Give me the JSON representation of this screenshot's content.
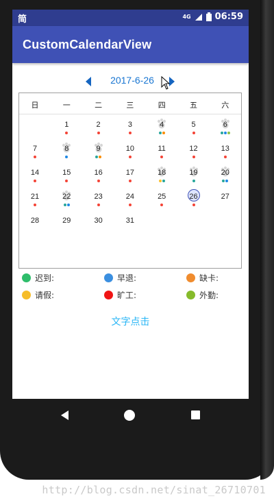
{
  "status_bar": {
    "carrier_icon_text": "简",
    "signal": "4G",
    "time": "06:59"
  },
  "app_bar": {
    "title": "CustomCalendarView"
  },
  "month_nav": {
    "label": "2017-6-26"
  },
  "calendar": {
    "weekdays": [
      "日",
      "一",
      "二",
      "三",
      "四",
      "五",
      "六"
    ],
    "days": [
      {
        "day": "1",
        "col": 1,
        "row": 0,
        "dots": [
          "#f44336"
        ]
      },
      {
        "day": "2",
        "col": 2,
        "row": 0,
        "dots": [
          "#f44336"
        ]
      },
      {
        "day": "3",
        "col": 3,
        "row": 0,
        "dots": [
          "#f44336"
        ]
      },
      {
        "day": "4",
        "col": 4,
        "row": 0,
        "paw": true,
        "dots": [
          "#26a69a",
          "#fb8c00"
        ]
      },
      {
        "day": "5",
        "col": 5,
        "row": 0,
        "dots": [
          "#f44336"
        ]
      },
      {
        "day": "6",
        "col": 6,
        "row": 0,
        "paw": true,
        "dots": [
          "#26a69a",
          "#1e88e5",
          "#8bc34a"
        ]
      },
      {
        "day": "7",
        "col": 0,
        "row": 1,
        "dots": [
          "#f44336"
        ]
      },
      {
        "day": "8",
        "col": 1,
        "row": 1,
        "paw": true,
        "dots": [
          "#1e88e5"
        ]
      },
      {
        "day": "9",
        "col": 2,
        "row": 1,
        "paw": true,
        "dots": [
          "#26a69a",
          "#fb8c00"
        ]
      },
      {
        "day": "10",
        "col": 3,
        "row": 1,
        "dots": [
          "#f44336"
        ]
      },
      {
        "day": "11",
        "col": 4,
        "row": 1,
        "dots": [
          "#f44336"
        ]
      },
      {
        "day": "12",
        "col": 5,
        "row": 1,
        "dots": [
          "#f44336"
        ]
      },
      {
        "day": "13",
        "col": 6,
        "row": 1,
        "dots": [
          "#f44336"
        ]
      },
      {
        "day": "14",
        "col": 0,
        "row": 2,
        "dots": [
          "#f44336"
        ]
      },
      {
        "day": "15",
        "col": 1,
        "row": 2,
        "dots": [
          "#f44336"
        ]
      },
      {
        "day": "16",
        "col": 2,
        "row": 2,
        "dots": [
          "#f44336"
        ]
      },
      {
        "day": "17",
        "col": 3,
        "row": 2,
        "dots": [
          "#f44336"
        ]
      },
      {
        "day": "18",
        "col": 4,
        "row": 2,
        "paw": true,
        "dots": [
          "#fbc02d",
          "#26a69a"
        ]
      },
      {
        "day": "19",
        "col": 5,
        "row": 2,
        "paw": true,
        "dots": [
          "#26a69a"
        ]
      },
      {
        "day": "20",
        "col": 6,
        "row": 2,
        "paw": true,
        "dots": [
          "#26a69a",
          "#1e88e5"
        ]
      },
      {
        "day": "21",
        "col": 0,
        "row": 3,
        "dots": [
          "#f44336"
        ]
      },
      {
        "day": "22",
        "col": 1,
        "row": 3,
        "paw": true,
        "dots": [
          "#26a69a",
          "#1e88e5"
        ]
      },
      {
        "day": "23",
        "col": 2,
        "row": 3,
        "dots": [
          "#f44336"
        ]
      },
      {
        "day": "24",
        "col": 3,
        "row": 3,
        "dots": [
          "#f44336"
        ]
      },
      {
        "day": "25",
        "col": 4,
        "row": 3,
        "dots": [
          "#f44336"
        ]
      },
      {
        "day": "26",
        "col": 5,
        "row": 3,
        "today": true,
        "dots": [
          "#f44336"
        ]
      },
      {
        "day": "27",
        "col": 6,
        "row": 3,
        "dots": []
      },
      {
        "day": "28",
        "col": 0,
        "row": 4,
        "dots": []
      },
      {
        "day": "29",
        "col": 1,
        "row": 4,
        "dots": []
      },
      {
        "day": "30",
        "col": 2,
        "row": 4,
        "dots": []
      },
      {
        "day": "31",
        "col": 3,
        "row": 4,
        "dots": []
      }
    ]
  },
  "legend": [
    {
      "label": "迟到:",
      "color": "#2ebd6b"
    },
    {
      "label": "早退:",
      "color": "#3b8fe0"
    },
    {
      "label": "缺卡:",
      "color": "#f08c2e"
    },
    {
      "label": "请假:",
      "color": "#f6bd29"
    },
    {
      "label": "旷工:",
      "color": "#f01414"
    },
    {
      "label": "外勤:",
      "color": "#86bb2b"
    }
  ],
  "text_click": {
    "label": "文字点击"
  },
  "watermark": {
    "text": "http://blog.csdn.net/sinat_26710701"
  }
}
